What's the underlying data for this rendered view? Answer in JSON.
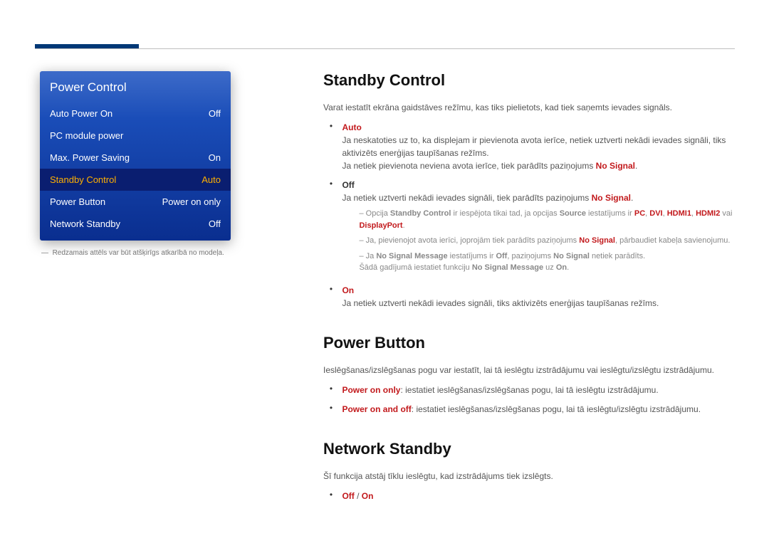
{
  "menu": {
    "title": "Power Control",
    "rows": [
      {
        "label": "Auto Power On",
        "value": "Off"
      },
      {
        "label": "PC module power",
        "value": ""
      },
      {
        "label": "Max. Power Saving",
        "value": "On"
      },
      {
        "label": "Standby Control",
        "value": "Auto"
      },
      {
        "label": "Power Button",
        "value": "Power on only"
      },
      {
        "label": "Network Standby",
        "value": "Off"
      }
    ]
  },
  "caption_prefix": "―",
  "caption": "Redzamais attēls var būt atšķirīgs atkarībā no modeļa.",
  "s1": {
    "title": "Standby Control",
    "lead": "Varat iestatīt ekrāna gaidstāves režīmu, kas tiks pielietots, kad tiek saņemts ievades signāls.",
    "auto": "Auto",
    "auto_l1a": "Ja neskatoties uz to, ka displejam ir pievienota avota ierīce, netiek uztverti nekādi ievades signāli, tiks aktivizēts enerģijas taupīšanas režīms.",
    "auto_l2a": "Ja netiek pievienota neviena avota ierīce, tiek parādīts paziņojums ",
    "nosig": "No Signal",
    "auto_l2b": ".",
    "off": "Off",
    "off_l1a": "Ja netiek uztverti nekādi ievades signāli, tiek parādīts paziņojums ",
    "sub1a": "Opcija ",
    "sub1b": "Standby Control",
    "sub1c": " ir iespējota tikai tad, ja opcijas ",
    "sub1d": "Source",
    "sub1e": " iestatījums ir ",
    "sub1f": "PC",
    "sub1g": ", ",
    "sub1h": "DVI",
    "sub1i": ", ",
    "sub1j": "HDMI1",
    "sub1k": ", ",
    "sub1l": "HDMI2",
    "sub1m": " vai ",
    "sub1n": "DisplayPort",
    "sub1o": ".",
    "sub2a": "Ja, pievienojot avota ierīci, joprojām tiek parādīts paziņojums ",
    "sub2b": ", pārbaudiet kabeļa savienojumu.",
    "sub3a": "Ja ",
    "sub3b": "No Signal Message",
    "sub3c": " iestatījums ir ",
    "sub3d": "Off",
    "sub3e": ", paziņojums ",
    "sub3f": " netiek parādīts.",
    "sub3g": "Šādā gadījumā iestatiet funkciju ",
    "sub3h": "No Signal Message",
    "sub3i": " uz ",
    "sub3j": "On",
    "sub3k": ".",
    "on": "On",
    "on_l1": "Ja netiek uztverti nekādi ievades signāli, tiks aktivizēts enerģijas taupīšanas režīms."
  },
  "s2": {
    "title": "Power Button",
    "lead": "Ieslēgšanas/izslēgšanas pogu var iestatīt, lai tā ieslēgtu izstrādājumu vai ieslēgtu/izslēgtu izstrādājumu.",
    "b1k": "Power on only",
    "b1t": ": iestatiet ieslēgšanas/izslēgšanas pogu, lai tā ieslēgtu izstrādājumu.",
    "b2k": "Power on and off",
    "b2t": ": iestatiet ieslēgšanas/izslēgšanas pogu, lai tā ieslēgtu/izslēgtu izstrādājumu."
  },
  "s3": {
    "title": "Network Standby",
    "lead": "Šī funkcija atstāj tīklu ieslēgtu, kad izstrādājums tiek izslēgts.",
    "off": "Off",
    "sep": " / ",
    "on": "On"
  }
}
